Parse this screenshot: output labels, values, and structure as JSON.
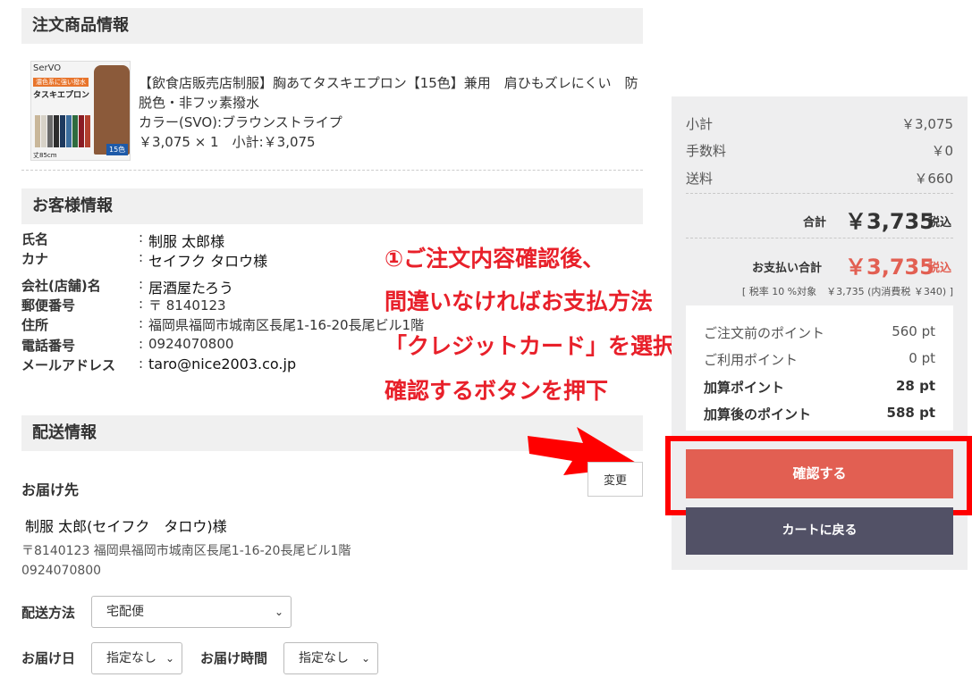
{
  "order_items": {
    "heading": "注文商品情報",
    "product": {
      "image": {
        "brand": "SerVO",
        "label": "濃色系に強い撥水",
        "title": "タスキエプロン",
        "size": "丈85cm",
        "badge": "15色"
      },
      "name": "【飲食店販売店制服】胸あてタスキエプロン【15色】兼用　肩ひもズレにくい　防脱色・非フッ素撥水",
      "color": "カラー(SVO):ブラウンストライプ",
      "price_line": "￥3,075 × 1　小計:￥3,075",
      "swatches": [
        "#c9b79a",
        "#d7d2c8",
        "#6b6b6b",
        "#2d2d2d",
        "#1e3a5f",
        "#3c6e9e",
        "#2f6b3f",
        "#8a1c24",
        "#b3412f",
        "#7a4b2a",
        "#4b3a2a",
        "#1b1b1b",
        "#f0efe8",
        "#d48d3b",
        "#5b6a3c"
      ]
    }
  },
  "customer": {
    "heading": "お客様情報",
    "rows": [
      {
        "label": "氏名",
        "value": "制服 太郎様"
      },
      {
        "label": "カナ",
        "value": "セイフク タロウ様"
      },
      {
        "label": "会社(店舗)名",
        "value": "居酒屋たろう"
      },
      {
        "label": "郵便番号",
        "value": "〒 8140123"
      },
      {
        "label": "住所",
        "value": "福岡県福岡市城南区長尾1-16-20長尾ビル1階"
      },
      {
        "label": "電話番号",
        "value": "0924070800"
      },
      {
        "label": "メールアドレス",
        "value": "taro@nice2003.co.jp"
      }
    ]
  },
  "annotation": {
    "lines": [
      "①ご注文内容確認後、",
      "間違いなければお支払方法",
      "「クレジットカード」を選択後、",
      "確認するボタンを押下"
    ]
  },
  "shipping": {
    "heading": "配送情報",
    "destination_label": "お届け先",
    "change_label": "変更",
    "recipient": "制服 太郎(セイフク　タロウ)様",
    "address": "〒8140123 福岡県福岡市城南区長尾1-16-20長尾ビル1階",
    "phone": "0924070800",
    "method_label": "配送方法",
    "method_value": "宅配便",
    "date_label": "お届け日",
    "date_value": "指定なし",
    "time_label": "お届け時間",
    "time_value": "指定なし"
  },
  "summary": {
    "subtotal_label": "小計",
    "subtotal": "￥3,075",
    "fee_label": "手数料",
    "fee": "￥0",
    "shipping_label": "送料",
    "shipping": "￥660",
    "total_label": "合計",
    "total": "￥3,735",
    "tax_in": "税込",
    "payment_label": "お支払い合計",
    "payment_total": "￥3,735",
    "payment_tax_in": "税込",
    "tax_note": "[ 税率 10 %対象　￥3,735 (内消費税 ￥340) ]",
    "accent_color": "#e25f52"
  },
  "points": {
    "before_label": "ご注文前のポイント",
    "before": "560 pt",
    "use_label": "ご利用ポイント",
    "use": "0 pt",
    "add_label": "加算ポイント",
    "add": "28 pt",
    "after_label": "加算後のポイント",
    "after": "588 pt"
  },
  "buttons": {
    "confirm": "確認する",
    "back": "カートに戻る"
  }
}
